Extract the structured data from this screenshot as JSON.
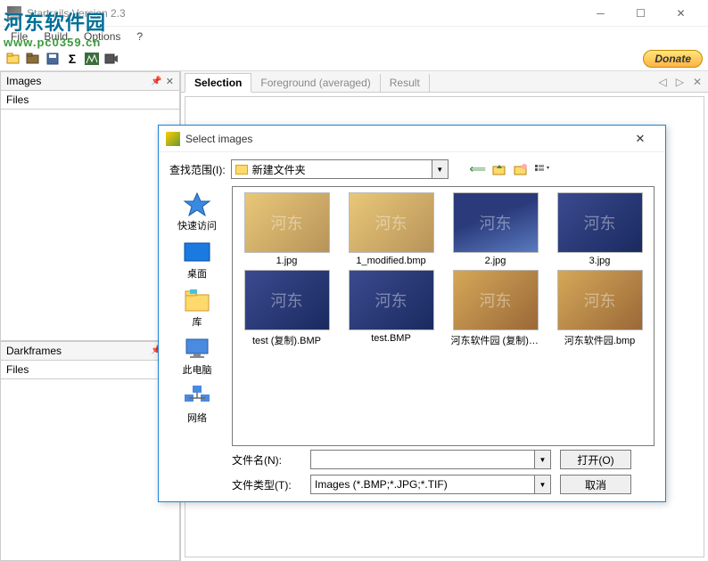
{
  "window": {
    "title": "Startrails Version 2.3"
  },
  "menu": {
    "file": "File",
    "build": "Build",
    "options": "Options",
    "help": "?"
  },
  "toolbar": {
    "donate": "Donate"
  },
  "panels": {
    "images": {
      "title": "Images",
      "sub": "Files"
    },
    "dark": {
      "title": "Darkframes",
      "sub": "Files"
    }
  },
  "tabs": {
    "selection": "Selection",
    "foreground": "Foreground (averaged)",
    "result": "Result"
  },
  "dialog": {
    "title": "Select images",
    "lookup_label": "查找范围(I):",
    "folder": "新建文件夹",
    "places": {
      "quick": "快速访问",
      "desktop": "桌面",
      "library": "库",
      "pc": "此电脑",
      "network": "网络"
    },
    "files": [
      {
        "name": "1.jpg",
        "cls": "anime1"
      },
      {
        "name": "1_modified.bmp",
        "cls": "anime1"
      },
      {
        "name": "2.jpg",
        "cls": "anime2"
      },
      {
        "name": "3.jpg",
        "cls": "anime3"
      },
      {
        "name": "test (复制).BMP",
        "cls": "anime3"
      },
      {
        "name": "test.BMP",
        "cls": "anime3"
      },
      {
        "name": "河东软件园 (复制).bmp",
        "cls": "anime4"
      },
      {
        "name": "河东软件园.bmp",
        "cls": "anime4"
      }
    ],
    "filename_label": "文件名(N):",
    "filetype_label": "文件类型(T):",
    "filetype_value": "Images (*.BMP;*.JPG;*.TIF)",
    "open_btn": "打开(O)",
    "cancel_btn": "取消"
  },
  "watermark": {
    "line1": "河东软件园",
    "line2": "www.pc0359.cn"
  }
}
